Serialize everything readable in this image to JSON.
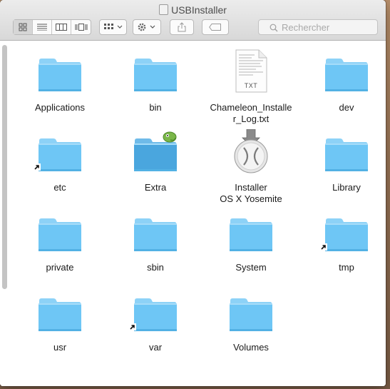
{
  "window": {
    "title": "USBInstaller",
    "search_placeholder": "Rechercher"
  },
  "toolbar": {
    "view_buttons": [
      "icon-view-icon",
      "list-view-icon",
      "column-view-icon",
      "coverflow-view-icon"
    ],
    "selected_view": "icon-view-icon"
  },
  "items": [
    {
      "label": "Applications",
      "type": "folder"
    },
    {
      "label": "bin",
      "type": "folder"
    },
    {
      "label": "Chameleon_Installe\nr_Log.txt",
      "type": "txt",
      "badge": "TXT"
    },
    {
      "label": "dev",
      "type": "folder"
    },
    {
      "label": "etc",
      "type": "folder-alias"
    },
    {
      "label": "Extra",
      "type": "folder-extra"
    },
    {
      "label": "Installer\nOS X Yosemite",
      "type": "installer"
    },
    {
      "label": "Library",
      "type": "folder"
    },
    {
      "label": "private",
      "type": "folder"
    },
    {
      "label": "sbin",
      "type": "folder"
    },
    {
      "label": "System",
      "type": "folder"
    },
    {
      "label": "tmp",
      "type": "folder-alias"
    },
    {
      "label": "usr",
      "type": "folder"
    },
    {
      "label": "var",
      "type": "folder-alias"
    },
    {
      "label": "Volumes",
      "type": "folder"
    }
  ],
  "colors": {
    "folder_body": "#6ec6f5",
    "folder_tab": "#8dd2f7"
  }
}
